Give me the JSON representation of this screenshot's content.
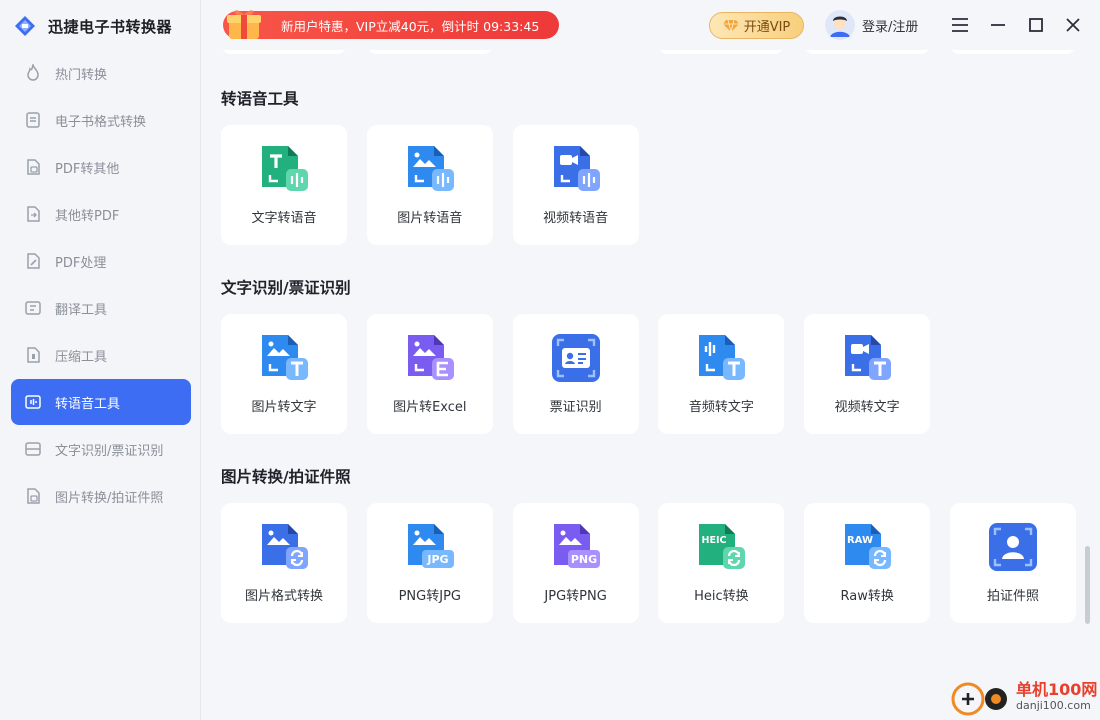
{
  "app": {
    "title": "迅捷电子书转换器"
  },
  "sidebar": {
    "items": [
      {
        "label": "热门转换",
        "icon": "flame-icon"
      },
      {
        "label": "电子书格式转换",
        "icon": "ebook-icon"
      },
      {
        "label": "PDF转其他",
        "icon": "pdf-convert-icon"
      },
      {
        "label": "其他转PDF",
        "icon": "to-pdf-icon"
      },
      {
        "label": "PDF处理",
        "icon": "pdf-edit-icon"
      },
      {
        "label": "翻译工具",
        "icon": "translate-icon"
      },
      {
        "label": "压缩工具",
        "icon": "compress-icon"
      },
      {
        "label": "转语音工具",
        "icon": "voice-icon",
        "active": true
      },
      {
        "label": "文字识别/票证识别",
        "icon": "ocr-icon"
      },
      {
        "label": "图片转换/拍证件照",
        "icon": "image-icon"
      }
    ]
  },
  "topbar": {
    "promo_text": "新用户特惠，VIP立减40元，倒计时 09:33:45",
    "vip_label": "开通VIP",
    "login_label": "登录/注册"
  },
  "sections": [
    {
      "title": "转语音工具",
      "cards": [
        {
          "label": "文字转语音",
          "icon": "text-to-speech-icon"
        },
        {
          "label": "图片转语音",
          "icon": "image-to-speech-icon"
        },
        {
          "label": "视频转语音",
          "icon": "video-to-speech-icon"
        }
      ]
    },
    {
      "title": "文字识别/票证识别",
      "cards": [
        {
          "label": "图片转文字",
          "icon": "image-to-text-icon"
        },
        {
          "label": "图片转Excel",
          "icon": "image-to-excel-icon"
        },
        {
          "label": "票证识别",
          "icon": "id-card-recognition-icon"
        },
        {
          "label": "音频转文字",
          "icon": "audio-to-text-icon"
        },
        {
          "label": "视频转文字",
          "icon": "video-to-text-icon"
        }
      ]
    },
    {
      "title": "图片转换/拍证件照",
      "cards": [
        {
          "label": "图片格式转换",
          "icon": "image-format-convert-icon"
        },
        {
          "label": "PNG转JPG",
          "icon": "png-to-jpg-icon",
          "badge": "JPG"
        },
        {
          "label": "JPG转PNG",
          "icon": "jpg-to-png-icon",
          "badge": "PNG"
        },
        {
          "label": "Heic转换",
          "icon": "heic-convert-icon",
          "badge": "HEIC"
        },
        {
          "label": "Raw转换",
          "icon": "raw-convert-icon",
          "badge": "RAW"
        },
        {
          "label": "拍证件照",
          "icon": "id-photo-icon"
        }
      ]
    }
  ],
  "watermark": {
    "line1": "单机100网",
    "line2": "danji100.com"
  },
  "colors": {
    "accent": "#3d6df2",
    "promo": "#f2433d",
    "green": "#2fbf8f",
    "blue": "#3b8df5",
    "purple": "#7a5cf0"
  }
}
